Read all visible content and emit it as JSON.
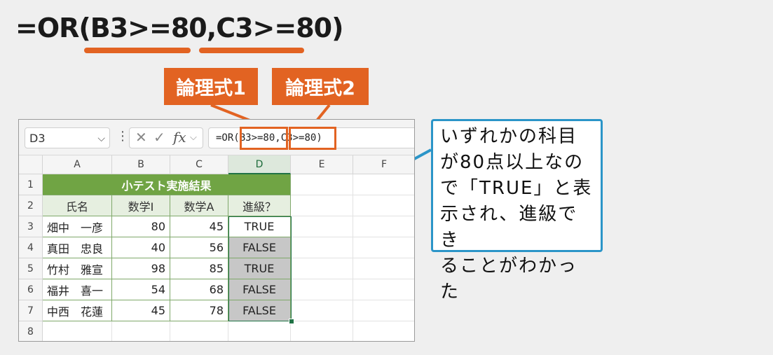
{
  "formula": {
    "prefix": "=OR(",
    "arg1": "B3>=80",
    "sep": ",",
    "arg2": "C3>=80",
    "suffix": ")"
  },
  "labels": {
    "logic1": "論理式1",
    "logic2": "論理式2"
  },
  "excel": {
    "name_box": "D3",
    "formula_bar": "=OR(B3>=80,C3>=80)",
    "formula_prefix": "=OR(",
    "formula_arg1": "B3>=80",
    "formula_sep": ",",
    "formula_arg2": "C3>=80",
    "formula_suffix": ")",
    "columns": [
      "A",
      "B",
      "C",
      "D",
      "E",
      "F"
    ],
    "rows": [
      "1",
      "2",
      "3",
      "4",
      "5",
      "6",
      "7",
      "8"
    ],
    "table_title": "小テスト実施結果",
    "headers": [
      "氏名",
      "数学Ⅰ",
      "数学A",
      "進級？"
    ],
    "data": [
      {
        "name": "畑中　一彦",
        "math1": "80",
        "mathA": "45",
        "result": "TRUE"
      },
      {
        "name": "真田　忠良",
        "math1": "40",
        "mathA": "56",
        "result": "FALSE"
      },
      {
        "name": "竹村　雅宣",
        "math1": "98",
        "mathA": "85",
        "result": "TRUE"
      },
      {
        "name": "福井　喜一",
        "math1": "54",
        "mathA": "68",
        "result": "FALSE"
      },
      {
        "name": "中西　花蓮",
        "math1": "45",
        "mathA": "78",
        "result": "FALSE"
      }
    ]
  },
  "callout": {
    "lines": [
      "いずれかの科目",
      "が80点以上なの",
      "で「TRUE」と表",
      "示され、進級でき",
      "ることがわかった"
    ]
  },
  "colors": {
    "accent_orange": "#e26322",
    "callout_blue": "#2b95c8",
    "excel_green": "#70a444"
  },
  "icons": [
    "chevron-down-icon",
    "more-options-icon",
    "cancel-icon",
    "enter-icon",
    "function-icon"
  ]
}
